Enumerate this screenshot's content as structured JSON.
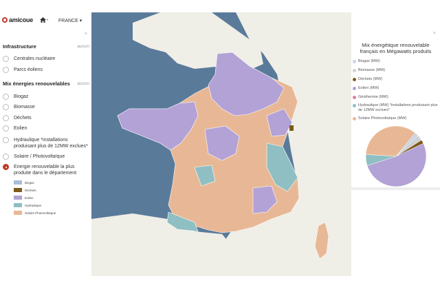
{
  "topbar": {
    "logo_text": "amicoue",
    "home_icon": "home-icon",
    "country_label": "FRANCE ▾"
  },
  "left_panel": {
    "close": "×",
    "infrastructure": {
      "title": "Infrastructure",
      "none_label": "aucun",
      "options": [
        "Centrales nucléaire",
        "Parcs éoliens"
      ]
    },
    "energy_mix": {
      "title": "Mix énergies renouvelables",
      "none_label": "aucun",
      "options": [
        "Biogaz",
        "Biomasse",
        "Déchets",
        "Eolien",
        "Hydraulique *installations produisant plus de 12MW exclues*",
        "Solaire / Photovoltaïque",
        "Energie renouvelable la plus produite dans le département"
      ],
      "selected_index": 6
    },
    "legend": [
      {
        "label": "Biogaz",
        "color": "#a9bcd9"
      },
      {
        "label": "Déchets",
        "color": "#7d5a1a"
      },
      {
        "label": "Eolien",
        "color": "#b3a2d6"
      },
      {
        "label": "Hydraulique",
        "color": "#8fbfc2"
      },
      {
        "label": "Solaire Photovoltaïque",
        "color": "#e8b896"
      }
    ]
  },
  "right_panel": {
    "close": "×",
    "title": "Mix énergétique renouvelable français en Mégawatts produits",
    "legend": [
      {
        "label": "Biogaz (MW)",
        "color": "#c8d4e6"
      },
      {
        "label": "Biomasse (MW)",
        "color": "#d0d0d0"
      },
      {
        "label": "Déchets (MW)",
        "color": "#7d5a1a"
      },
      {
        "label": "Eolien (MW)",
        "color": "#b3a2d6"
      },
      {
        "label": "Géothermie (MW)",
        "color": "#e07fa8"
      },
      {
        "label": "Hydraulique (MW) *installations produisant plus de 12MW exclues*",
        "color": "#8fbfc2"
      },
      {
        "label": "Solaire Photovoltaïque (MW)",
        "color": "#e8b896"
      }
    ],
    "pie": [
      {
        "name": "Biogaz",
        "value": 2,
        "color": "#c8d4e6"
      },
      {
        "name": "Biomasse",
        "value": 3,
        "color": "#d0d0d0"
      },
      {
        "name": "Déchets",
        "value": 2,
        "color": "#7d5a1a"
      },
      {
        "name": "Eolien",
        "value": 52,
        "color": "#b3a2d6"
      },
      {
        "name": "Hydraulique",
        "value": 6,
        "color": "#8fbfc2"
      },
      {
        "name": "Solaire Photovoltaïque",
        "value": 35,
        "color": "#e8b896"
      }
    ]
  },
  "map": {
    "sea_color": "#5a7a9a",
    "land_color": "#efeee7"
  }
}
